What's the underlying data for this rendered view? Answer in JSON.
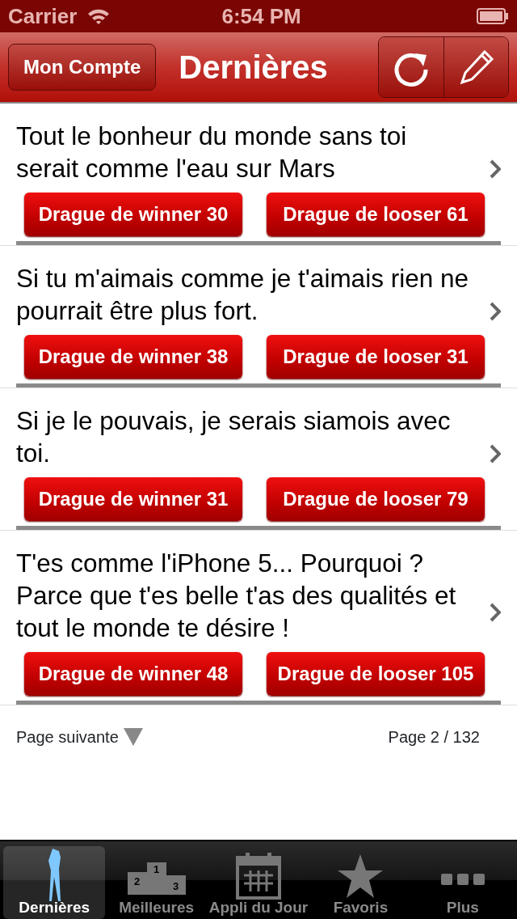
{
  "status_bar": {
    "carrier": "Carrier",
    "time": "6:54 PM"
  },
  "nav_bar": {
    "left_button": "Mon Compte",
    "title": "Dernières"
  },
  "quotes": [
    {
      "text": "Tout le bonheur du monde sans toi serait comme l'eau sur Mars",
      "winner": "Drague de winner 30",
      "looser": "Drague de looser 61"
    },
    {
      "text": "Si tu m'aimais comme je t'aimais rien ne pourrait être plus fort.",
      "winner": "Drague de winner 38",
      "looser": "Drague de looser 31"
    },
    {
      "text": "Si je le pouvais, je serais siamois avec toi.",
      "winner": "Drague de winner 31",
      "looser": "Drague de looser 79"
    },
    {
      "text": "T'es comme l'iPhone 5... Pourquoi ? Parce que t'es belle t'as des qualités et tout le monde te désire !",
      "winner": "Drague de winner 48",
      "looser": "Drague de looser 105"
    }
  ],
  "pager": {
    "next": "Page suivante",
    "page": "Page 2 / 132"
  },
  "tab_bar": [
    {
      "label": "Dernières",
      "kind": "figure",
      "selected": true
    },
    {
      "label": "Meilleures",
      "kind": "podium",
      "selected": false,
      "digits": [
        "2",
        "1",
        "3"
      ]
    },
    {
      "label": "Appli du Jour",
      "kind": "calendar",
      "selected": false
    },
    {
      "label": "Favoris",
      "kind": "star",
      "selected": false
    },
    {
      "label": "Plus",
      "kind": "more",
      "selected": false
    }
  ]
}
